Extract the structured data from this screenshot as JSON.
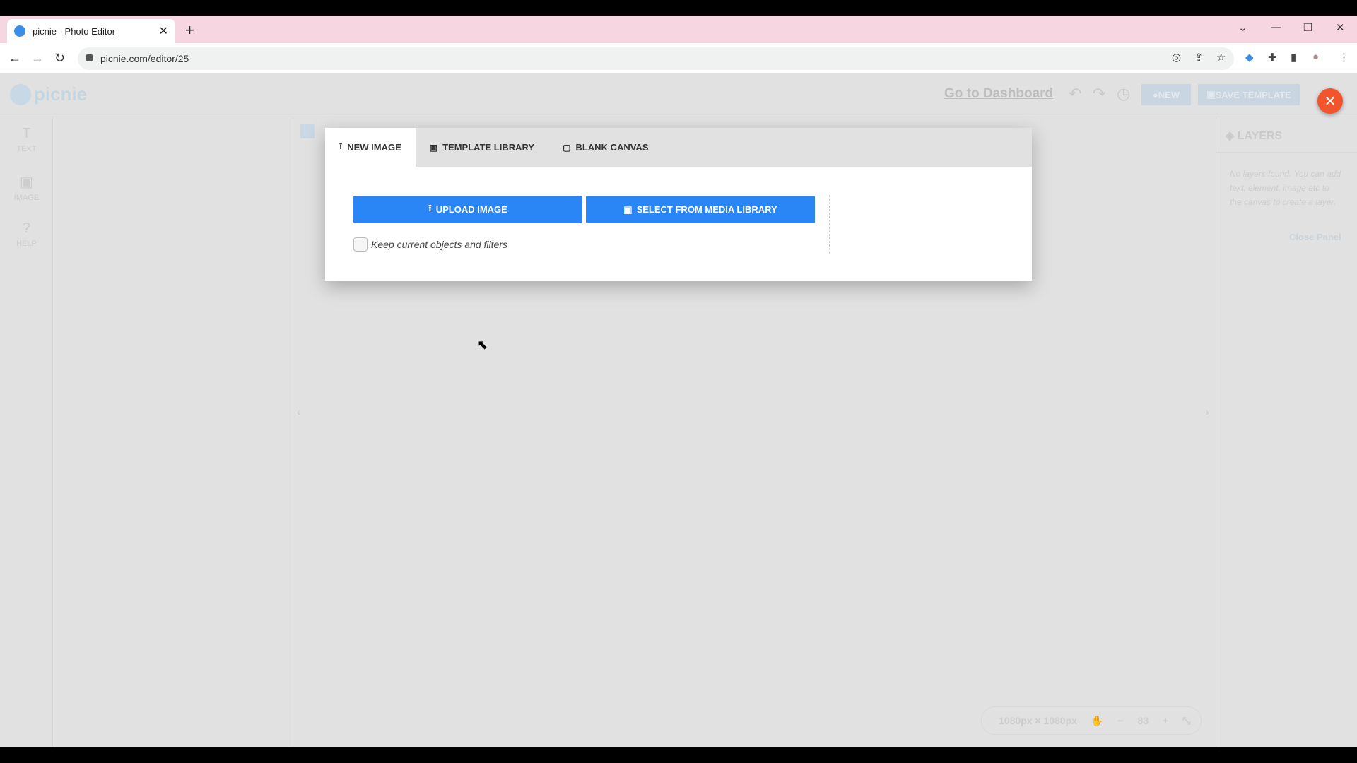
{
  "browser": {
    "tab_title": "picnie - Photo Editor",
    "url": "picnie.com/editor/25"
  },
  "app": {
    "logo": "picnie",
    "header": {
      "dashboard_link": "Go to Dashboard",
      "new_label": "NEW",
      "save_template_label": "SAVE TEMPLATE"
    },
    "sidebar": {
      "items": [
        {
          "label": "TEXT",
          "icon": "text-icon"
        },
        {
          "label": "IMAGE",
          "icon": "image-icon"
        },
        {
          "label": "HELP",
          "icon": "help-icon"
        }
      ]
    },
    "layers": {
      "title": "LAYERS",
      "empty_text": "No layers found. You can add text, element, image etc to the canvas to create a layer.",
      "close_panel": "Close Panel"
    },
    "zoombar": {
      "dimensions": "1080px × 1080px",
      "zoom": "83",
      "minus": "−",
      "plus": "+"
    }
  },
  "modal": {
    "tabs": [
      {
        "label": "NEW IMAGE",
        "icon": "upload-icon",
        "active": true
      },
      {
        "label": "TEMPLATE LIBRARY",
        "icon": "library-icon"
      },
      {
        "label": "BLANK CANVAS",
        "icon": "canvas-icon"
      }
    ],
    "upload_button": "UPLOAD IMAGE",
    "media_button": "SELECT FROM MEDIA LIBRARY",
    "keep_checkbox": {
      "label": "Keep current objects and filters",
      "checked": false
    }
  },
  "colors": {
    "primary": "#2a86f5",
    "close_fab": "#f2552c",
    "tab_bar": "#f6d6e1"
  }
}
